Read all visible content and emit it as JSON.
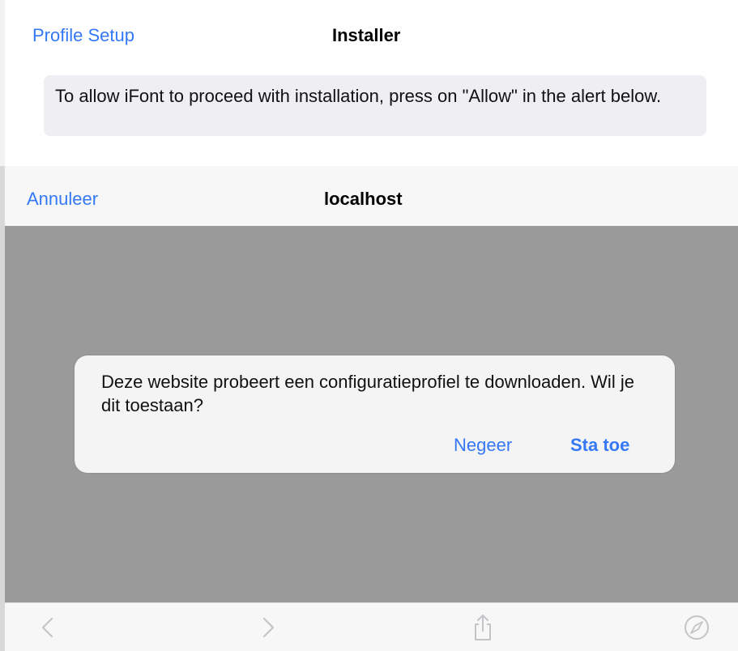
{
  "installer": {
    "back_label": "Profile Setup",
    "title": "Installer",
    "instruction": "To allow iFont to proceed with installation, press on \"Allow\" in the alert below."
  },
  "browser": {
    "cancel_label": "Annuleer",
    "title": "localhost"
  },
  "alert": {
    "message": "Deze website probeert een configuratieprofiel te downloaden. Wil je dit toestaan?",
    "ignore_label": "Negeer",
    "allow_label": "Sta toe"
  },
  "toolbar": {
    "icons": [
      "chevron-left-icon",
      "chevron-right-icon",
      "share-icon",
      "compass-icon"
    ]
  },
  "colors": {
    "accent": "#3478f6",
    "dim_overlay": "#9a9a9a",
    "info_box": "#efeff3",
    "toolbar_icon_disabled": "#c4c4c8"
  }
}
